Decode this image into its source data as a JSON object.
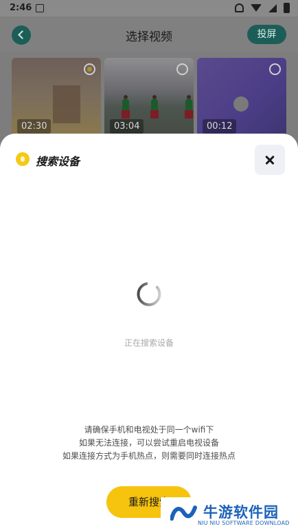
{
  "status_bar": {
    "time": "2:46"
  },
  "header": {
    "title": "选择视频",
    "cast_label": "投屏"
  },
  "videos": [
    {
      "duration": "02:30"
    },
    {
      "duration": "03:04"
    },
    {
      "duration": "00:12"
    }
  ],
  "sheet": {
    "title": "搜索设备",
    "searching": "正在搜索设备",
    "hints": [
      "请确保手机和电视处于同一个wifi下",
      "如果无法连接，可以尝试重启电视设备",
      "如果连接方式为手机热点，则需要同时连接热点"
    ],
    "research_button": "重新搜索"
  },
  "watermark": {
    "name": "牛游软件园",
    "subtitle": "NIU NIU SOFTWARE DOWNLOAD"
  },
  "colors": {
    "accent": "#1c5e57",
    "button_yellow": "#f6c30e",
    "brand_blue": "#1b62b8"
  }
}
